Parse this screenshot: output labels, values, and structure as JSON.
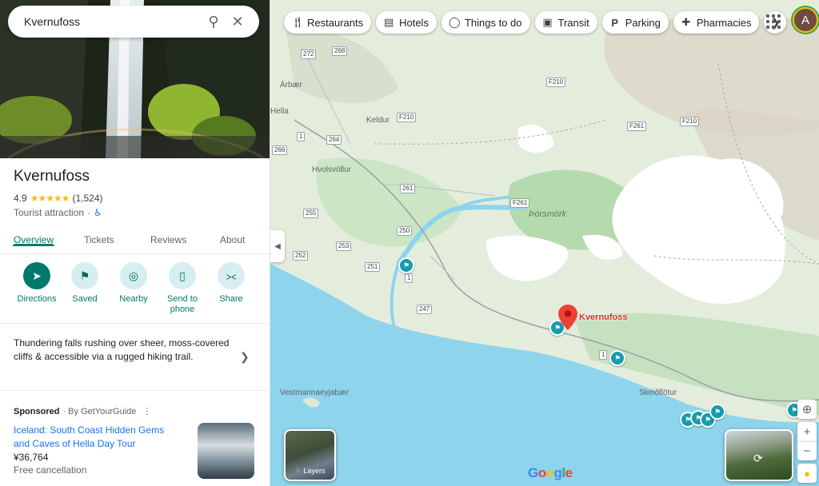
{
  "search": {
    "value": "Kvernufoss"
  },
  "place": {
    "name": "Kvernufoss",
    "rating": "4.9",
    "stars": "★★★★★",
    "review_count": "(1,524)",
    "category": "Tourist attraction",
    "separator": "·"
  },
  "tabs": [
    {
      "label": "Overview"
    },
    {
      "label": "Tickets"
    },
    {
      "label": "Reviews"
    },
    {
      "label": "About"
    }
  ],
  "actions": [
    {
      "label": "Directions"
    },
    {
      "label": "Saved"
    },
    {
      "label": "Nearby"
    },
    {
      "label": "Send to phone"
    },
    {
      "label": "Share"
    }
  ],
  "description": "Thundering falls rushing over sheer, moss-covered cliffs & accessible via a rugged hiking trail.",
  "sponsored": {
    "label": "Sponsored",
    "by": "· By GetYourGuide",
    "title": "Iceland: South Coast Hidden Gems and Caves of Hella Day Tour",
    "price": "¥36,764",
    "note": "Free cancellation"
  },
  "chips": [
    {
      "label": "Restaurants",
      "icon": "fork-knife-icon"
    },
    {
      "label": "Hotels",
      "icon": "bed-icon"
    },
    {
      "label": "Things to do",
      "icon": "camera-icon"
    },
    {
      "label": "Transit",
      "icon": "train-icon"
    },
    {
      "label": "Parking",
      "icon": "parking-icon"
    },
    {
      "label": "Pharmacies",
      "icon": "pharmacy-icon"
    }
  ],
  "avatar_letter": "A",
  "map": {
    "places": [
      "Árbær",
      "Hella",
      "Keldur",
      "Hvolsvöllur",
      "Þórsmörk",
      "Vestmannaeyjabær",
      "Skeiðflötur"
    ],
    "roads": [
      "272",
      "268",
      "F210",
      "F210",
      "F261",
      "F210",
      "1",
      "264",
      "266",
      "261",
      "F261",
      "255",
      "250",
      "253",
      "251",
      "252",
      "247",
      "1",
      "1"
    ],
    "pin_label": "Kvernufoss",
    "layers_label": "Layers",
    "logo": [
      "G",
      "o",
      "o",
      "g",
      "l",
      "e"
    ]
  },
  "colors": {
    "accent": "#00796b",
    "water": "#8ed4ec",
    "glacier": "#ffffff",
    "pin": "#d93025",
    "poi": "#129eaf"
  }
}
